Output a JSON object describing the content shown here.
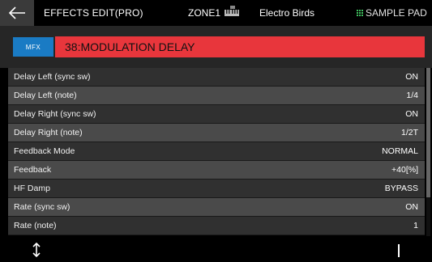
{
  "header": {
    "title": "EFFECTS EDIT(PRO)",
    "zone": "ZONE1",
    "scene": "Electro Birds",
    "pad_label": "SAMPLE PAD",
    "pad_icon_color": "#3fbf5f"
  },
  "mfx": {
    "button_label": "MFX",
    "effect_name": "38:MODULATION DELAY",
    "name_bg_color": "#e8363c",
    "button_color": "#1a7bc4"
  },
  "params": [
    {
      "label": "Delay Left (sync sw)",
      "value": "ON"
    },
    {
      "label": "Delay Left (note)",
      "value": "1/4"
    },
    {
      "label": "Delay Right (sync sw)",
      "value": "ON"
    },
    {
      "label": "Delay Right (note)",
      "value": "1/2T"
    },
    {
      "label": "Feedback Mode",
      "value": "NORMAL"
    },
    {
      "label": "Feedback",
      "value": "+40[%]"
    },
    {
      "label": "HF Damp",
      "value": "BYPASS"
    },
    {
      "label": "Rate (sync sw)",
      "value": "ON"
    },
    {
      "label": "Rate (note)",
      "value": "1"
    }
  ],
  "footer": {
    "left_icon": "up-down-arrow-icon",
    "right_icon": "cursor-bar-icon"
  }
}
